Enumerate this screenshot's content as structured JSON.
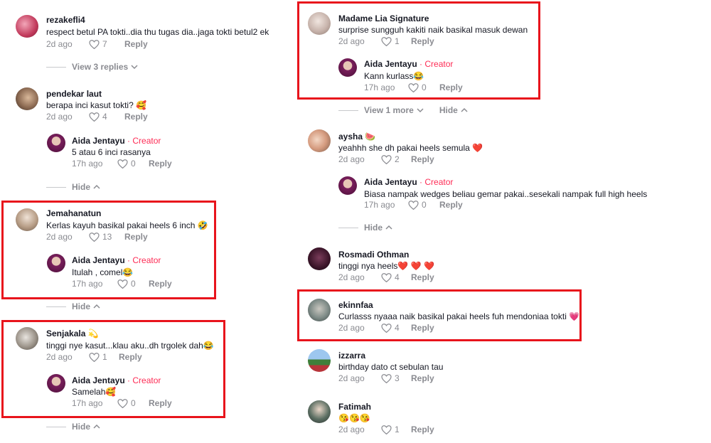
{
  "colors": {
    "accent": "#fe2c55",
    "highlight": "#e8141c",
    "muted": "#8a8b91"
  },
  "icons": {
    "like": "heart-outline-icon",
    "chevron_down": "chevron-down-icon",
    "chevron_up": "chevron-up-icon"
  },
  "comments": {
    "rezakefli": {
      "name": "rezakefli4",
      "text": "respect betul PA tokti..dia thu tugas dia..jaga tokti betul2 ek",
      "date": "2d ago",
      "likes": "7",
      "reply": "Reply",
      "view_replies": "View 3 replies"
    },
    "pendekar": {
      "name": "pendekar laut",
      "text": "berapa inci kasut tokti? 🥰",
      "date": "2d ago",
      "likes": "4",
      "reply": "Reply",
      "sub": {
        "name": "Aida Jentayu",
        "creator": " · Creator",
        "text": "5 atau 6 inci rasanya",
        "date": "17h ago",
        "likes": "0",
        "reply": "Reply"
      },
      "hide": "Hide"
    },
    "jemahanatun": {
      "name": "Jemahanatun",
      "text": "Kerlas kayuh basikal pakai heels 6 inch 🤣",
      "date": "2d ago",
      "likes": "13",
      "reply": "Reply",
      "sub": {
        "name": "Aida Jentayu",
        "creator": " · Creator",
        "text": "Itulah , comel😂",
        "date": "17h ago",
        "likes": "0",
        "reply": "Reply"
      },
      "hide": "Hide"
    },
    "senjakala": {
      "name": "Senjakala 💫",
      "text": "tinggi nye kasut...klau aku..dh trgolek dah😂",
      "date": "2d ago",
      "likes": "1",
      "reply": "Reply",
      "sub": {
        "name": "Aida Jentayu",
        "creator": " · Creator",
        "text": "Samelah🥰",
        "date": "17h ago",
        "likes": "0",
        "reply": "Reply"
      },
      "hide": "Hide"
    },
    "madame": {
      "name": "Madame Lia Signature",
      "text": "surprise sungguh kakiti naik basikal masuk dewan",
      "date": "2d ago",
      "likes": "1",
      "reply": "Reply",
      "sub": {
        "name": "Aida Jentayu",
        "creator": " · Creator",
        "text": "Kann kurlass😂",
        "date": "17h ago",
        "likes": "0",
        "reply": "Reply"
      },
      "view_more": "View 1 more",
      "hide": "Hide"
    },
    "aysha": {
      "name": "aysha 🍉",
      "text": "yeahhh she dh pakai heels semula ❤️",
      "date": "2d ago",
      "likes": "2",
      "reply": "Reply",
      "sub": {
        "name": "Aida Jentayu",
        "creator": " · Creator",
        "text": "Biasa nampak wedges beliau gemar pakai..sesekali nampak full high heels",
        "date": "17h ago",
        "likes": "0",
        "reply": "Reply"
      },
      "hide": "Hide"
    },
    "rosmadi": {
      "name": "Rosmadi Othman",
      "text": "tinggi nya heels❤️ ❤️ ❤️",
      "date": "2d ago",
      "likes": "4",
      "reply": "Reply"
    },
    "ekinnfaa": {
      "name": "ekinnfaa",
      "text": "Curlasss nyaaa naik basikal pakai heels fuh mendoniaa tokti 💗",
      "date": "2d ago",
      "likes": "4",
      "reply": "Reply"
    },
    "izzarra": {
      "name": "izzarra",
      "text": "birthday dato ct sebulan tau",
      "date": "2d ago",
      "likes": "3",
      "reply": "Reply"
    },
    "fatimah": {
      "name": "Fatimah",
      "text": "😘😘😘",
      "date": "2d ago",
      "likes": "1",
      "reply": "Reply"
    }
  }
}
